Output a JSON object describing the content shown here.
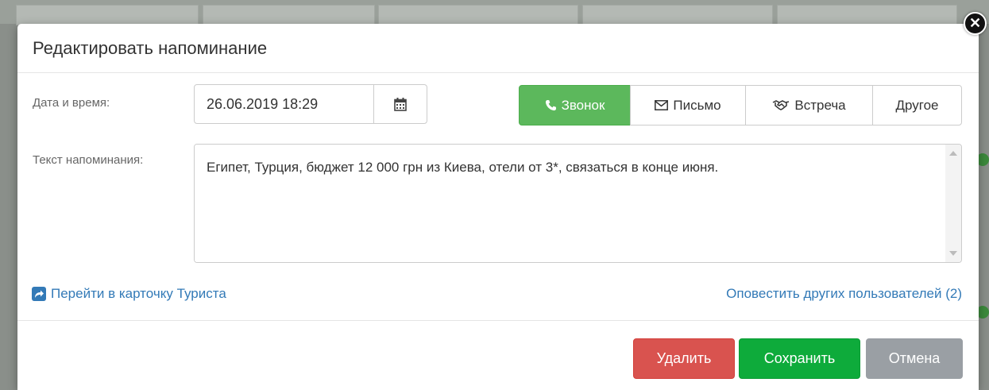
{
  "dialog": {
    "title": "Редактировать напоминание",
    "close_symbol": "✕"
  },
  "form": {
    "date_label": "Дата и время:",
    "date_value": "26.06.2019 18:29",
    "text_label": "Текст напоминания:",
    "text_value": "Египет, Турция, бюджет 12 000 грн из Киева, отели от 3*, связаться в конце июня."
  },
  "types": [
    {
      "label": "Звонок",
      "icon": "phone-icon",
      "active": true
    },
    {
      "label": "Письмо",
      "icon": "envelope-icon",
      "active": false
    },
    {
      "label": "Встреча",
      "icon": "handshake-icon",
      "active": false
    },
    {
      "label": "Другое",
      "icon": "",
      "active": false
    }
  ],
  "links": {
    "tourist_card": "Перейти в карточку Туриста",
    "notify_users": "Оповестить других пользователей (2)"
  },
  "buttons": {
    "delete": "Удалить",
    "save": "Сохранить",
    "cancel": "Отмена"
  },
  "colors": {
    "active_type": "#5cb85c",
    "delete": "#d9534f",
    "save": "#0eab3b",
    "cancel": "#9a9fa4",
    "link": "#337ab7"
  }
}
